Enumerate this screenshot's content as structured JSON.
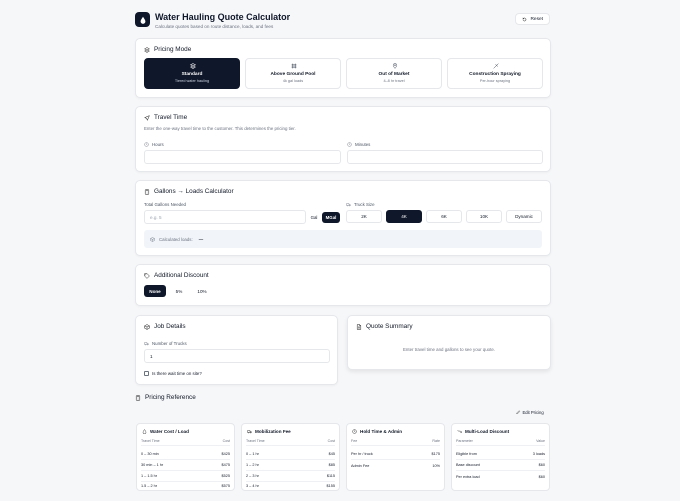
{
  "header": {
    "title": "Water Hauling Quote Calculator",
    "subtitle": "Calculate quotes based on route distance, loads, and fees",
    "reset_label": "Reset"
  },
  "pricing_mode": {
    "title": "Pricing Mode",
    "options": [
      {
        "label": "Standard",
        "sub": "Tiered water hauling",
        "icon": "layers-icon",
        "active": true
      },
      {
        "label": "Above Ground Pool",
        "sub": "4k gal loads",
        "icon": "pool-icon",
        "active": false
      },
      {
        "label": "Out of Market",
        "sub": "4–8 hr travel",
        "icon": "map-pin-icon",
        "active": false
      },
      {
        "label": "Construction Spraying",
        "sub": "Per-hour spraying",
        "icon": "sprayer-icon",
        "active": false
      }
    ]
  },
  "travel_time": {
    "title": "Travel Time",
    "description": "Enter the one-way travel time to the customer. This determines the pricing tier.",
    "hours_label": "Hours",
    "minutes_label": "Minutes",
    "hours_value": "",
    "minutes_value": ""
  },
  "gallons": {
    "title": "Gallons → Loads Calculator",
    "total_label": "Total Gallons Needed",
    "total_placeholder": "e.g. 5",
    "unit_gal": "Gal",
    "unit_mgal": "MGal",
    "active_unit": "MGal",
    "truck_size_label": "Truck Size",
    "truck_sizes": [
      "2K",
      "4K",
      "6K",
      "10K",
      "Dynamic"
    ],
    "active_truck_size": "4K",
    "calculated_label": "Calculated loads:",
    "calculated_value": "—"
  },
  "discount": {
    "title": "Additional Discount",
    "options": [
      "None",
      "5%",
      "10%"
    ],
    "active": "None"
  },
  "job_details": {
    "title": "Job Details",
    "trucks_label": "Number of Trucks",
    "trucks_value": "1",
    "wait_label": "Is there wait time on site?"
  },
  "quote_summary": {
    "title": "Quote Summary",
    "empty_text": "Enter travel time and gallons to see your quote."
  },
  "pricing_reference": {
    "title": "Pricing Reference",
    "edit_label": "Edit Pricing",
    "tables": [
      {
        "title": "Water Cost / Load",
        "icon": "droplet-icon",
        "headers": [
          "Travel Time",
          "Cost"
        ],
        "rows": [
          [
            "0 – 30 min",
            "$425"
          ],
          [
            "30 min – 1 hr",
            "$475"
          ],
          [
            "1 – 1.5 hr",
            "$525"
          ],
          [
            "1.5 – 2 hr",
            "$575"
          ]
        ]
      },
      {
        "title": "Mobilization Fee",
        "icon": "truck-icon",
        "headers": [
          "Travel Time",
          "Cost"
        ],
        "rows": [
          [
            "0 – 1 hr",
            "$45"
          ],
          [
            "1 – 2 hr",
            "$85"
          ],
          [
            "2 – 3 hr",
            "$115"
          ],
          [
            "3 – 4 hr",
            "$155"
          ]
        ]
      },
      {
        "title": "Hold Time & Admin",
        "icon": "clock-icon",
        "headers": [
          "Fee",
          "Rate"
        ],
        "rows": [
          [
            "Per hr / truck",
            "$175"
          ],
          [
            "Admin Fee",
            "10%"
          ]
        ]
      },
      {
        "title": "Multi-Load Discount",
        "icon": "trend-down-icon",
        "headers": [
          "Parameter",
          "Value"
        ],
        "rows": [
          [
            "Eligible from",
            "3 loads"
          ],
          [
            "Base discount",
            "$60"
          ],
          [
            "Per extra load",
            "$60"
          ]
        ]
      }
    ]
  },
  "colors": {
    "primary": "#0f172a",
    "page_background": "#f6f7f9",
    "border": "#e5e7eb",
    "muted_text": "#6b7280"
  }
}
